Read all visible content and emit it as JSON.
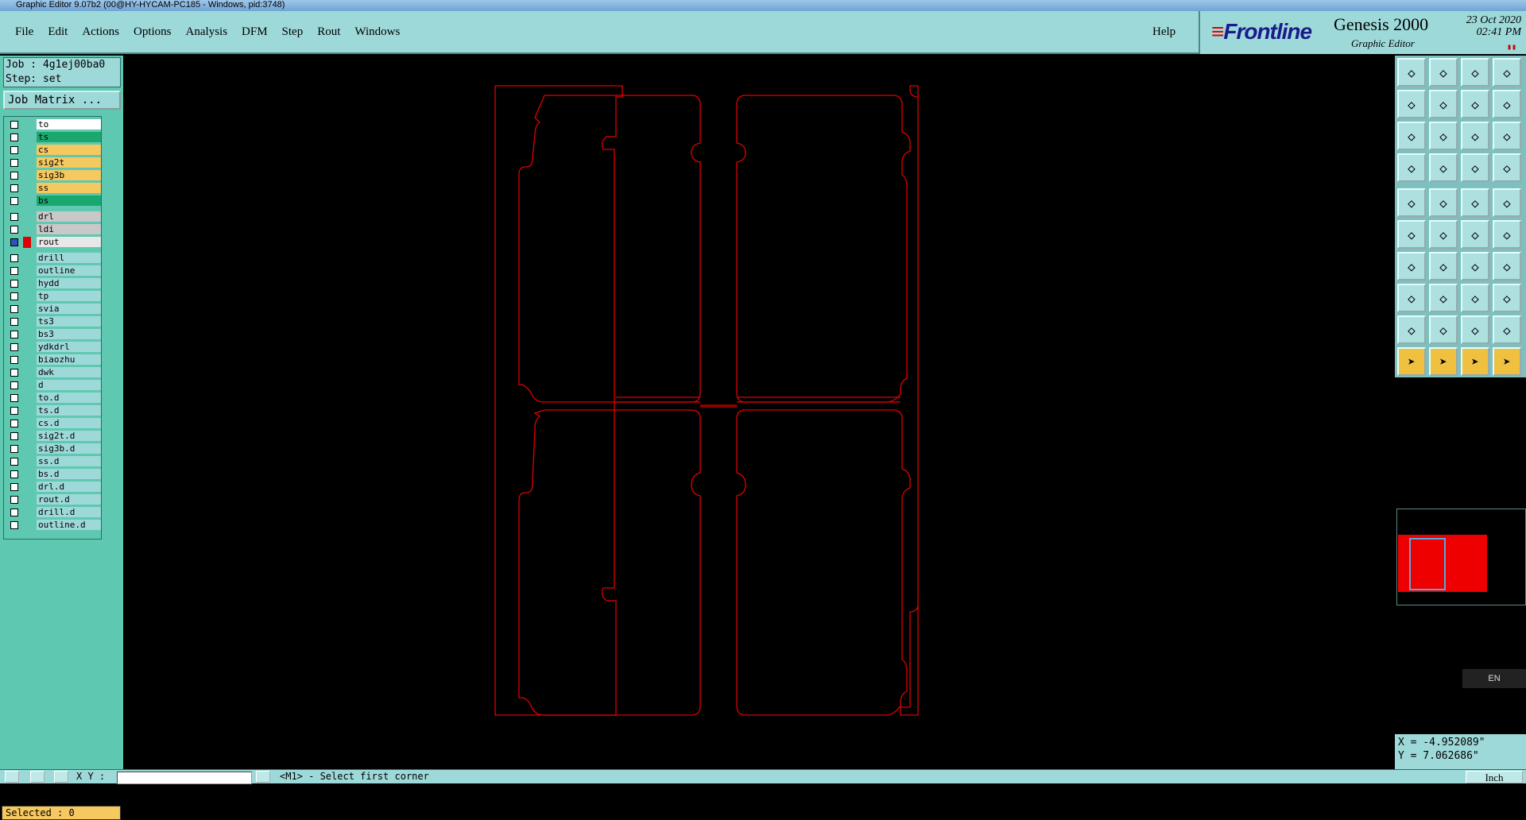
{
  "window": {
    "title": "Graphic Editor 9.07b2 (00@HY-HYCAM-PC185 - Windows, pid:3748)"
  },
  "menu": {
    "items": [
      {
        "label": "File",
        "key": "F"
      },
      {
        "label": "Edit",
        "key": "E"
      },
      {
        "label": "Actions",
        "key": "A"
      },
      {
        "label": "Options",
        "key": "O"
      },
      {
        "label": "Analysis",
        "key": "A"
      },
      {
        "label": "DFM",
        "key": ""
      },
      {
        "label": "Step",
        "key": "S"
      },
      {
        "label": "Rout",
        "key": "R"
      },
      {
        "label": "Windows",
        "key": "W"
      }
    ],
    "help": "Help"
  },
  "brand": {
    "logo": "Frontline",
    "product": "Genesis 2000",
    "subtitle": "Graphic Editor",
    "date": "23 Oct 2020",
    "time": "02:41 PM"
  },
  "job": {
    "job_label": "Job : 4g1ej00ba0",
    "step_label": "Step: set",
    "matrix_button": "Job Matrix ..."
  },
  "layers": [
    {
      "name": "to",
      "color": "#ffffff"
    },
    {
      "name": "ts",
      "color": "#1aa86e"
    },
    {
      "name": "cs",
      "color": "#f5c860"
    },
    {
      "name": "sig2t",
      "color": "#f5c860"
    },
    {
      "name": "sig3b",
      "color": "#f5c860"
    },
    {
      "name": "ss",
      "color": "#f5c860"
    },
    {
      "name": "bs",
      "color": "#1aa86e"
    },
    {
      "name": "drl",
      "color": "#c8c8c8"
    },
    {
      "name": "ldi",
      "color": "#c8c8c8"
    },
    {
      "name": "rout",
      "color": "#e8e8e8",
      "active": true
    },
    {
      "name": "drill",
      "color": "#9ed9d9"
    },
    {
      "name": "outline",
      "color": "#9ed9d9"
    },
    {
      "name": "hydd",
      "color": "#9ed9d9"
    },
    {
      "name": "tp",
      "color": "#9ed9d9"
    },
    {
      "name": "svia",
      "color": "#9ed9d9"
    },
    {
      "name": "ts3",
      "color": "#9ed9d9"
    },
    {
      "name": "bs3",
      "color": "#9ed9d9"
    },
    {
      "name": "ydkdrl",
      "color": "#9ed9d9"
    },
    {
      "name": "biaozhu",
      "color": "#9ed9d9"
    },
    {
      "name": "dwk",
      "color": "#9ed9d9"
    },
    {
      "name": "d",
      "color": "#9ed9d9"
    },
    {
      "name": "to.d",
      "color": "#9ed9d9"
    },
    {
      "name": "ts.d",
      "color": "#9ed9d9"
    },
    {
      "name": "cs.d",
      "color": "#9ed9d9"
    },
    {
      "name": "sig2t.d",
      "color": "#9ed9d9"
    },
    {
      "name": "sig3b.d",
      "color": "#9ed9d9"
    },
    {
      "name": "ss.d",
      "color": "#9ed9d9"
    },
    {
      "name": "bs.d",
      "color": "#9ed9d9"
    },
    {
      "name": "drl.d",
      "color": "#9ed9d9"
    },
    {
      "name": "rout.d",
      "color": "#9ed9d9"
    },
    {
      "name": "drill.d",
      "color": "#9ed9d9"
    },
    {
      "name": "outline.d",
      "color": "#9ed9d9"
    }
  ],
  "selected": "Selected : 0",
  "coords": {
    "x": "X = -4.952089\"",
    "y": "Y = 7.062686\""
  },
  "ime": "EN",
  "status": {
    "xy_label": "X Y :",
    "message": "<M1> - Select first corner",
    "units": "Inch"
  },
  "colors": {
    "rout": "#e00000",
    "panel": "#9ed9d9",
    "layerpanel": "#5fc8b0"
  },
  "tools": [
    "home-out",
    "home-in",
    "home",
    "grid-split",
    "pan-left",
    "pan-right",
    "undo-view",
    "redo-view",
    "zoom-fit",
    "zoom-center",
    "1:2",
    "help",
    "settings",
    "grid",
    "snap-red",
    "snap-blue",
    "camera",
    "board-view",
    "ruler",
    "dot",
    "link",
    "cross",
    "line-dot",
    "line-dot2",
    "angle",
    "line",
    "arc",
    "flip",
    "pad-cross",
    "minus",
    "measure",
    "pad-blue",
    "triangle",
    "triangle2",
    "arch",
    "arch2",
    "pointer",
    "pointer2",
    "pointer3",
    "pointer4"
  ]
}
